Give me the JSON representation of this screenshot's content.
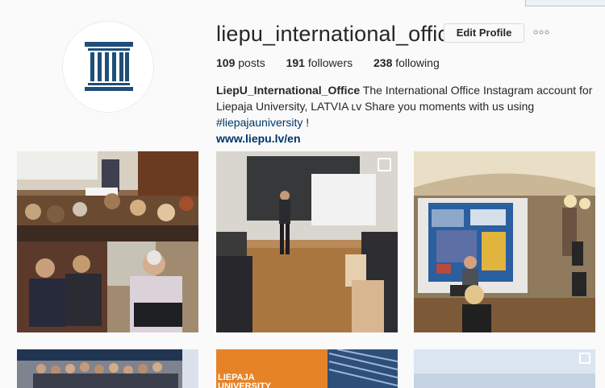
{
  "profile": {
    "username": "liepu_international_office",
    "edit_button": "Edit Profile",
    "more_icon": "more-options-icon",
    "avatar_icon": "university-building-icon",
    "brand_color": "#1f4e79"
  },
  "stats": {
    "posts_count": "109",
    "posts_label": "posts",
    "followers_count": "191",
    "followers_label": "followers",
    "following_count": "238",
    "following_label": "following"
  },
  "bio": {
    "name": "LiepU_International_Office",
    "text_before": " The International Office Instagram account for Liepaja University, LATVIA ʟᴠ Share you moments with us using ",
    "hashtag": "#liepajauniversity",
    "text_after": " !",
    "link": "www.liepu.lv/en"
  },
  "posts": {
    "third_row_label": "LIEPAJA\nUNIVERSITY"
  }
}
